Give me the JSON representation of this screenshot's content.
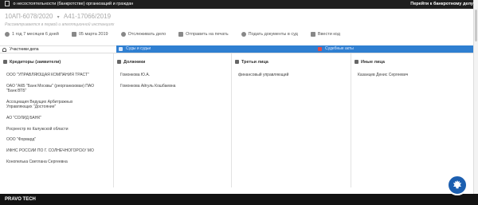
{
  "topbar": {
    "title": "о несостоятельности (банкротстве) организаций и граждан",
    "right_link": "Перейти к банкротному делу"
  },
  "case": {
    "first_number": "10АП-6078/2020",
    "second_number": "А41-17066/2019",
    "subtitle": "Рассматривается в первой и апелляционной инстанциях"
  },
  "toolbar": {
    "duration": "1 год 7 месяцев 6 дней",
    "date": "05 марта 2019",
    "unsubscribe": "Отслеживать дело",
    "print": "Отправить на печать",
    "submit": "Подать документы в суд",
    "enter_code": "Ввести код"
  },
  "tabs": [
    {
      "label": "Участники дела"
    },
    {
      "label": "Суды и судьи"
    },
    {
      "label": "Судебные акты"
    }
  ],
  "columns": {
    "creditors": {
      "header": "Кредиторы (заявители)",
      "items": [
        "ООО \"УПРАВЛЯЮЩАЯ КОМПАНИЯ ТРАСТ\"",
        "ОАО \"АКБ \"Банк Москвы\" (реорганизован) ПАО",
        "\"Банк ВТБ\"",
        "Ассоциация Ведущих Арбитражных",
        "Управляющих \"Достояние\"",
        "АО \"СОЛИД БАНК\"",
        "Росреестр по Калужской области",
        "ООО \"Форвард\"",
        "ИФНС РОССИИ ПО Г. СОЛНЕЧНОГОРСКУ МО",
        "Конопелька Светлана Сергеевна"
      ]
    },
    "debtors": {
      "header": "Должники",
      "items": [
        "Гомонкова Ю.А.",
        "Гомонкова Айгуль Кошбаевна"
      ]
    },
    "third": {
      "header": "Третьи лица",
      "items": [
        "финансовый управляющий"
      ]
    },
    "other": {
      "header": "Иные лица",
      "items": [
        "Казанцев Денис Сергеевич"
      ]
    }
  },
  "footer": {
    "brand": "PRAVO TECH"
  },
  "colors": {
    "tab_blue": "#2f7fd1",
    "footer": "#121212",
    "seal": "#1c5fb0"
  }
}
